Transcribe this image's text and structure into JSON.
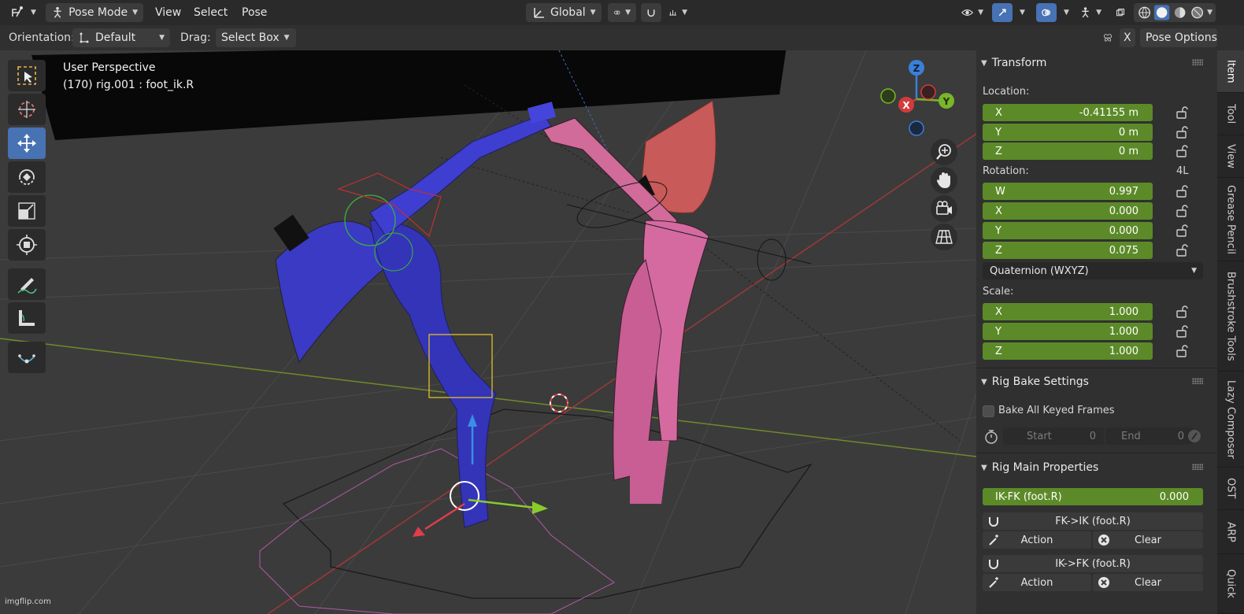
{
  "header": {
    "mode_label": "Pose Mode",
    "menus": [
      "View",
      "Select",
      "Pose"
    ],
    "transform_orientation": "Global",
    "colors": {
      "bar": "#2a2a2a",
      "accent": "#4772b3"
    }
  },
  "tool_header": {
    "orientation_label": "Orientation:",
    "orientation_value": "Default",
    "drag_label": "Drag:",
    "drag_value": "Select Box",
    "x_button": "X",
    "pose_options": "Pose Options"
  },
  "viewport": {
    "view_name": "User Perspective",
    "object_info": "(170) rig.001 : foot_ik.R",
    "gizmo_axes": {
      "x": "X",
      "y": "Y",
      "z": "Z"
    },
    "tools": [
      "select-box-tool-icon",
      "cursor-tool-icon",
      "move-tool-icon",
      "rotate-tool-icon",
      "scale-tool-icon",
      "transform-tool-icon",
      "annotate-tool-icon",
      "measure-tool-icon",
      "bone-envelope-tool-icon"
    ],
    "nav_buttons": [
      "zoom-icon",
      "hand-pan-icon",
      "camera-icon",
      "grid-ortho-icon"
    ]
  },
  "sidebar": {
    "tabs": [
      "Item",
      "Tool",
      "View",
      "Grease Pencil",
      "Brushstroke Tools",
      "Lazy Composer",
      "OST",
      "ARP",
      "Quick"
    ],
    "active_tab": "Item",
    "transform": {
      "title": "Transform",
      "location_label": "Location:",
      "location": [
        {
          "axis": "X",
          "value": "-0.41155 m"
        },
        {
          "axis": "Y",
          "value": "0 m"
        },
        {
          "axis": "Z",
          "value": "0 m"
        }
      ],
      "rotation_label": "Rotation:",
      "rotation_lock_label": "4L",
      "rotation": [
        {
          "axis": "W",
          "value": "0.997"
        },
        {
          "axis": "X",
          "value": "0.000"
        },
        {
          "axis": "Y",
          "value": "0.000"
        },
        {
          "axis": "Z",
          "value": "0.075"
        }
      ],
      "rotation_mode": "Quaternion (WXYZ)",
      "scale_label": "Scale:",
      "scale": [
        {
          "axis": "X",
          "value": "1.000"
        },
        {
          "axis": "Y",
          "value": "1.000"
        },
        {
          "axis": "Z",
          "value": "1.000"
        }
      ]
    },
    "rig_bake": {
      "title": "Rig Bake Settings",
      "bake_all_label": "Bake All Keyed Frames",
      "start_label": "Start",
      "start_value": "0",
      "end_label": "End",
      "end_value": "0"
    },
    "rig_main": {
      "title": "Rig Main Properties",
      "ikfk_label": "IK-FK (foot.R)",
      "ikfk_value": "0.000",
      "fk_to_ik": "FK->IK (foot.R)",
      "ik_to_fk": "IK->FK (foot.R)",
      "action_label": "Action",
      "clear_label": "Clear"
    },
    "colors": {
      "field_green": "#5c8a28",
      "panel_bg": "#303030"
    }
  },
  "watermark": "imgflip.com"
}
